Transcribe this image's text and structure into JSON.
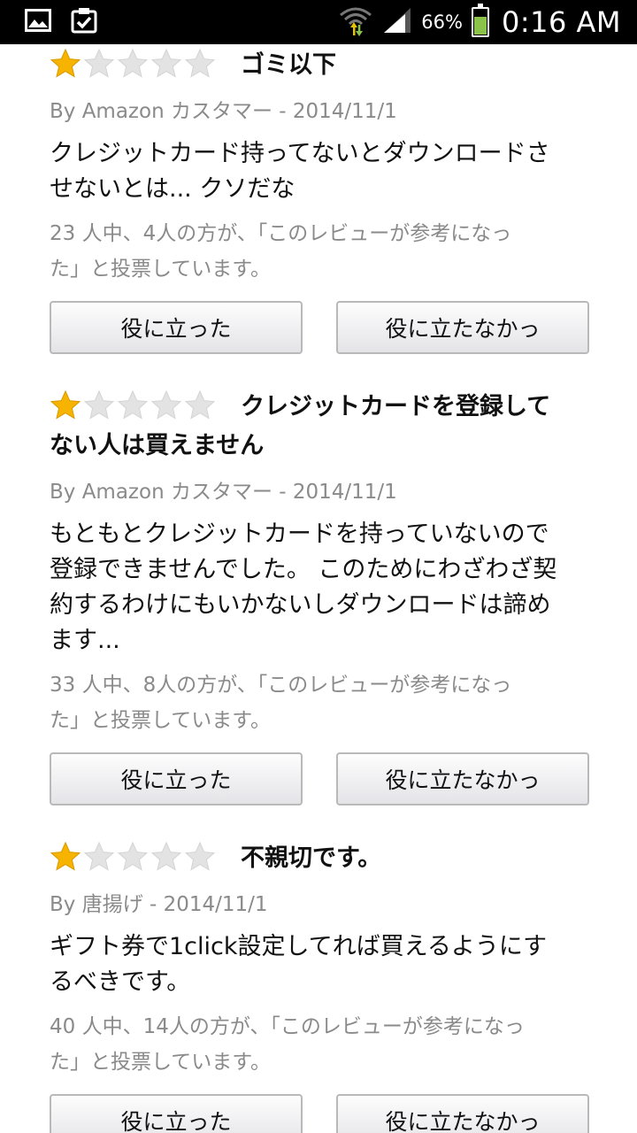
{
  "status_bar": {
    "time": "0:16 AM",
    "battery_percent": "66%",
    "battery_level": 0.66,
    "left_icons": [
      "image-icon",
      "clipboard-check-icon"
    ],
    "right_icons": [
      "wifi-icon",
      "signal-icon",
      "battery-icon"
    ]
  },
  "reviews": [
    {
      "rating": 1,
      "max_rating": 5,
      "title": "ゴミ以下",
      "meta": "By Amazon カスタマー - 2014/11/1",
      "body_lines": [
        "クレジットカード持ってないとダウンロードさ",
        "せないとは... クソだな"
      ],
      "helpful_lines": [
        "23 人中、4人の方が、「このレビューが参考になっ",
        "た」と投票しています。"
      ],
      "helpful_button": "役に立った",
      "not_helpful_button": "役に立たなかっ"
    },
    {
      "rating": 1,
      "max_rating": 5,
      "title_lines": [
        "クレジットカードを登録して",
        "ない人は買えません"
      ],
      "meta": "By Amazon カスタマー - 2014/11/1",
      "body_lines": [
        "もともとクレジットカードを持っていないので",
        "登録できませんでした。 このためにわざわざ契",
        "約するわけにもいかないしダウンロードは諦め",
        "ます..."
      ],
      "helpful_lines": [
        "33 人中、8人の方が、「このレビューが参考になっ",
        "た」と投票しています。"
      ],
      "helpful_button": "役に立った",
      "not_helpful_button": "役に立たなかっ"
    },
    {
      "rating": 1,
      "max_rating": 5,
      "title": "不親切です。",
      "meta": "By 唐揚げ - 2014/11/1",
      "body_lines": [
        "ギフト券で1click設定してれば買えるようにす",
        "るべきです。"
      ],
      "helpful_lines": [
        "40 人中、14人の方が、「このレビューが参考になっ",
        "た」と投票しています。"
      ],
      "helpful_button": "役に立った",
      "not_helpful_button": "役に立たなかっ"
    }
  ],
  "colors": {
    "star_filled": "#f6b400",
    "star_empty": "#e3e3e3",
    "meta_text": "#8a8a8a",
    "battery_fill": "#8bc34a"
  }
}
